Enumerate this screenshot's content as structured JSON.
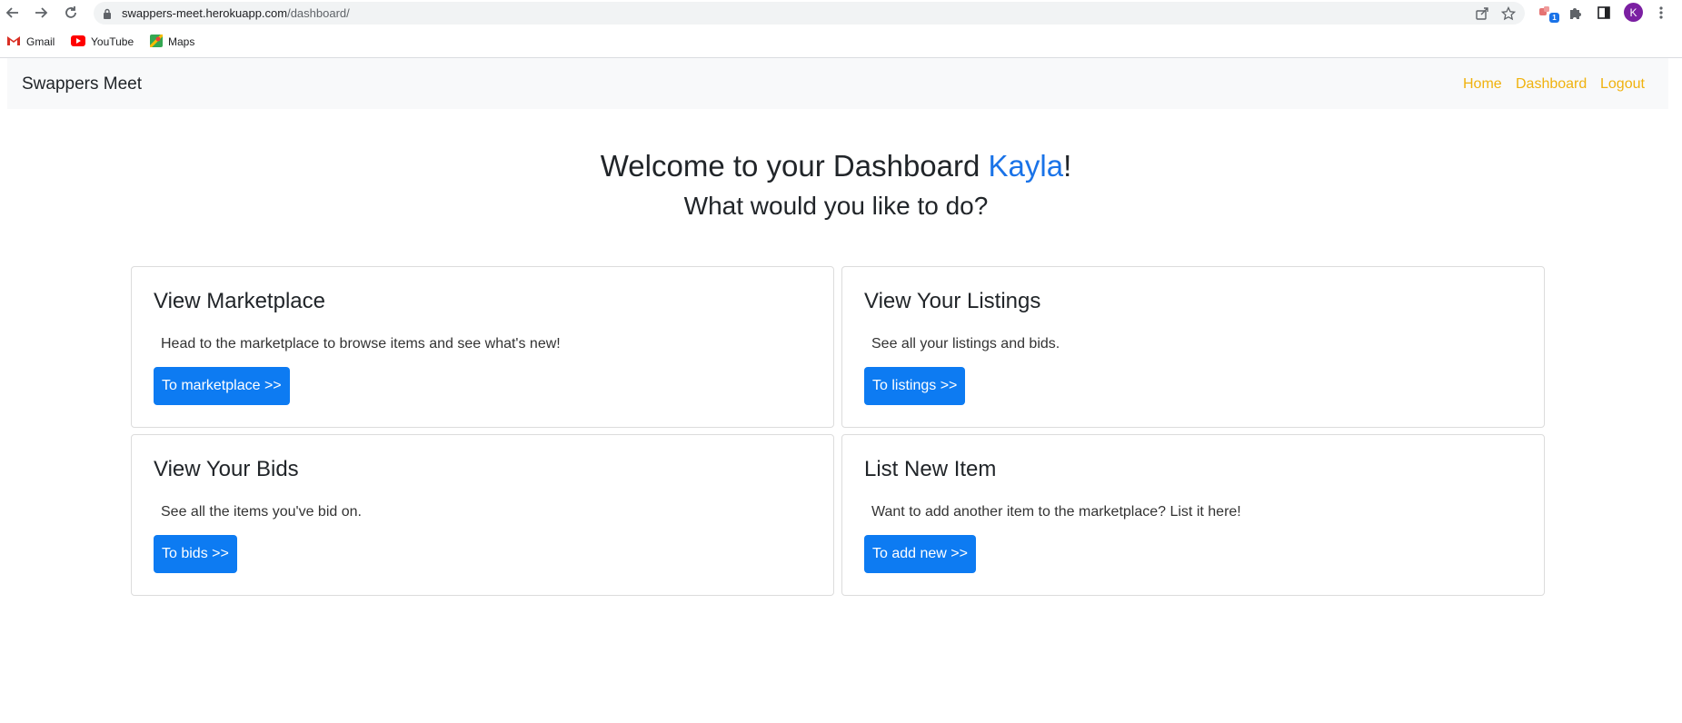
{
  "browser": {
    "url_host": "swappers-meet.herokuapp.com",
    "url_path": "/dashboard/",
    "extension_badge": "1",
    "profile_initial": "K",
    "bookmarks": [
      {
        "label": "Gmail",
        "icon": "gmail-icon"
      },
      {
        "label": "YouTube",
        "icon": "youtube-icon"
      },
      {
        "label": "Maps",
        "icon": "maps-icon"
      }
    ]
  },
  "navbar": {
    "brand": "Swappers Meet",
    "links": [
      "Home",
      "Dashboard",
      "Logout"
    ],
    "link_color": "#f0b20e"
  },
  "welcome": {
    "prefix": "Welcome to your Dashboard ",
    "name": "Kayla",
    "suffix": "!",
    "subtitle": "What would you like to do?"
  },
  "cards": [
    {
      "title": "View Marketplace",
      "text": "Head to the marketplace to browse items and see what's new!",
      "button": "To marketplace >>"
    },
    {
      "title": "View Your Listings",
      "text": "See all your listings and bids.",
      "button": "To listings >>"
    },
    {
      "title": "View Your Bids",
      "text": "See all the items you've bid on.",
      "button": "To bids >>"
    },
    {
      "title": "List New Item",
      "text": "Want to add another item to the marketplace? List it here!",
      "button": "To add new >>"
    }
  ],
  "colors": {
    "primary_button": "#0d7bf2",
    "name_accent": "#1a73e8"
  }
}
